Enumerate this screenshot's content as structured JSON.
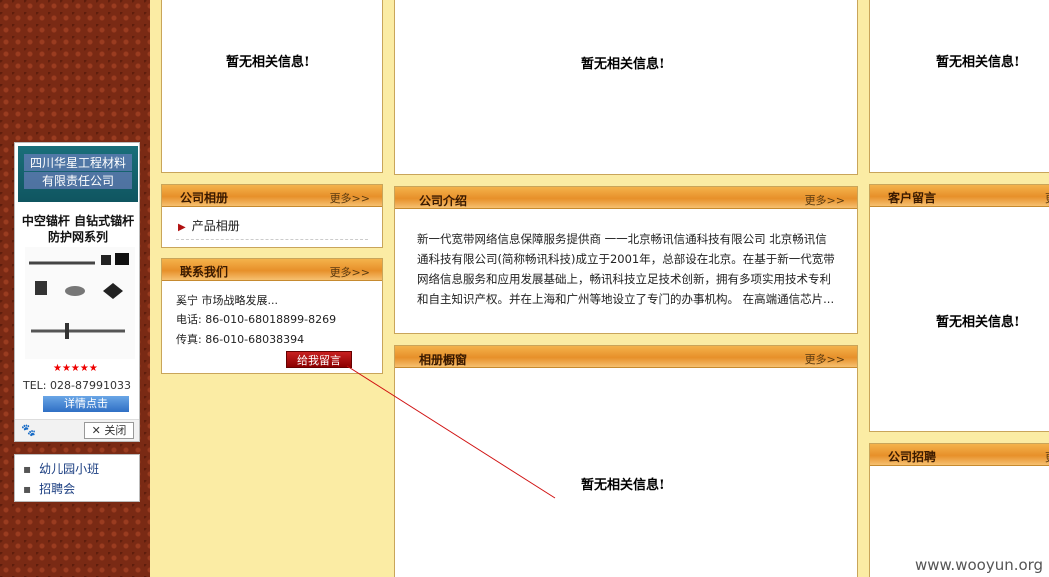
{
  "empty_message": "暂无相关信息!",
  "ad": {
    "company_line1": "四川华星工程材料",
    "company_line2": "有限责任公司",
    "product_line1": "中空锚杆 自钻式锚杆",
    "product_line2": "防护网系列",
    "stars": "★★★★★",
    "tel": "TEL: 028-87991033",
    "details_label": "详情点击",
    "close_label": "✕ 关闭"
  },
  "left_nav": {
    "items": [
      {
        "label": "幼儿园小班"
      },
      {
        "label": "招聘会"
      }
    ]
  },
  "panels": {
    "company_album": {
      "title": "公司相册",
      "more": "更多>>",
      "item": "产品相册"
    },
    "contact": {
      "title": "联系我们",
      "more": "更多>>",
      "line1": "奚宁 市场战略发展...",
      "phone": "电话: 86-010-68018899-8269",
      "fax": "传真: 86-010-68038394",
      "message_button": "给我留言"
    },
    "about": {
      "title": "公司介绍",
      "more": "更多>>",
      "text": "新一代宽带网络信息保障服务提供商 一一北京畅讯信通科技有限公司 北京畅讯信通科技有限公司(简称畅讯科技)成立于2001年，总部设在北京。在基于新一代宽带网络信息服务和应用发展基础上，畅讯科技立足技术创新，拥有多项实用技术专利和自主知识产权。并在上海和广州等地设立了专门的办事机构。 在高端通信芯片..."
    },
    "album_window": {
      "title": "相册橱窗",
      "more": "更多>>"
    },
    "guestbook": {
      "title": "客户留言",
      "more": "更"
    },
    "recruit": {
      "title": "公司招聘",
      "more": "更"
    }
  },
  "watermark": "www.wooyun.org"
}
